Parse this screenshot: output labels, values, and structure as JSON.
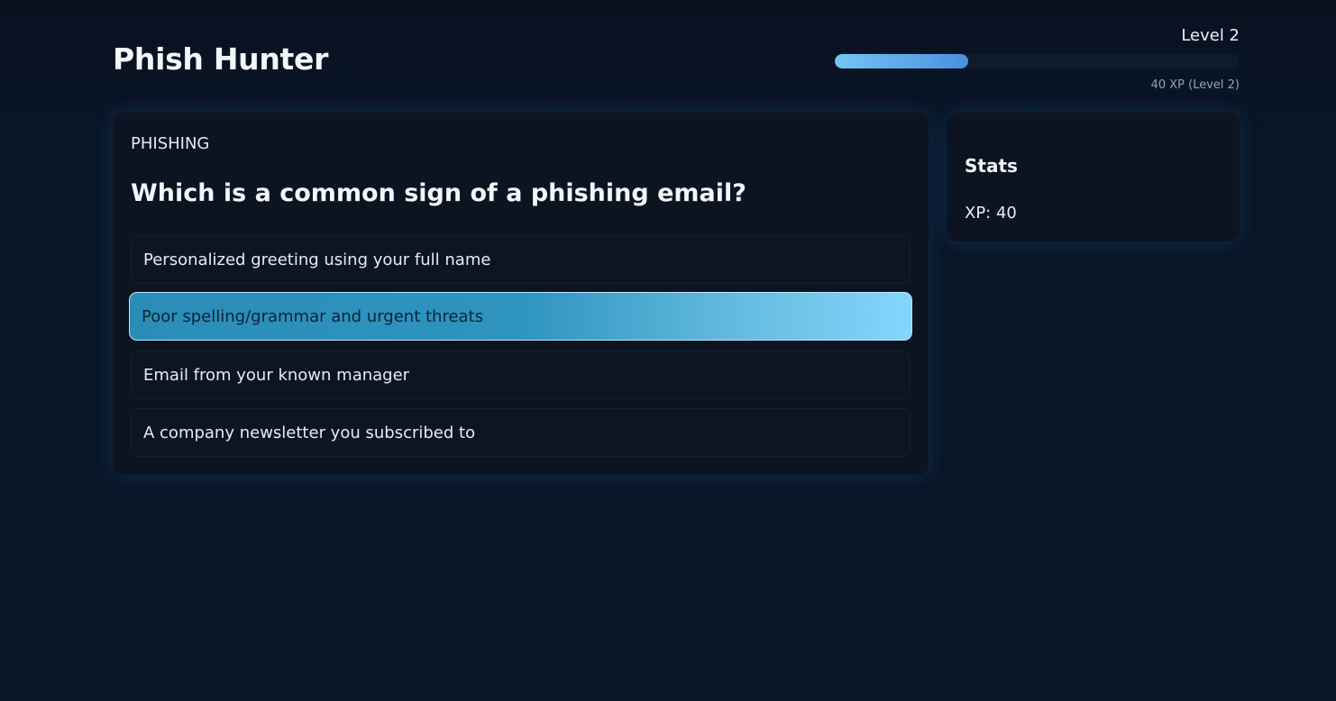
{
  "app": {
    "title": "Phish Hunter"
  },
  "progress": {
    "level_label": "Level 2",
    "xp_caption": "40 XP (Level 2)",
    "fill_fraction": 0.33
  },
  "quiz": {
    "category": "PHISHING",
    "question": "Which is a common sign of a phishing email?",
    "options": [
      {
        "label": "Personalized greeting using your full name",
        "selected": false
      },
      {
        "label": "Poor spelling/grammar and urgent threats",
        "selected": true
      },
      {
        "label": "Email from your known manager",
        "selected": false
      },
      {
        "label": "A company newsletter you subscribed to",
        "selected": false
      }
    ]
  },
  "stats": {
    "title": "Stats",
    "xp": "XP: 40"
  },
  "colors": {
    "background": "#0a1628",
    "card": "#0c1421",
    "accent": "#84d6fc"
  }
}
